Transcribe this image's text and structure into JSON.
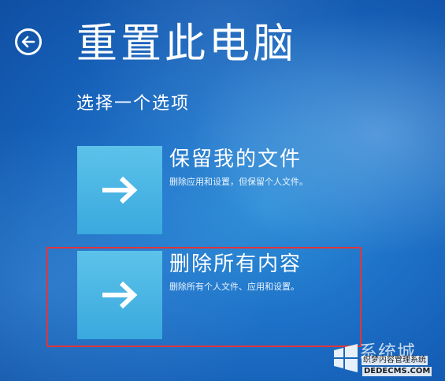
{
  "header": {
    "back_icon": "back-arrow-icon",
    "title": "重置此电脑"
  },
  "subtitle": "选择一个选项",
  "options": [
    {
      "title": "保留我的文件",
      "description": "删除应用和设置，但保留个人文件。",
      "icon": "arrow-right-icon"
    },
    {
      "title": "删除所有内容",
      "description": "删除所有个人文件、应用和设置。",
      "icon": "arrow-right-icon",
      "highlighted": true
    }
  ],
  "colors": {
    "background": "#1e73c9",
    "tile": "#45b3e2",
    "highlight": "#e0353a"
  },
  "watermark": {
    "name": "系统城",
    "subtitle": "织梦内容管理系统",
    "url": "DEDECMS.COM"
  }
}
